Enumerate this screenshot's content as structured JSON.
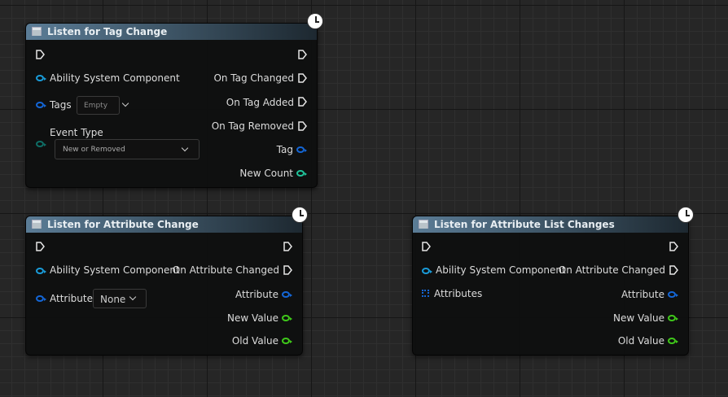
{
  "nodes": {
    "tag_change": {
      "title": "Listen for Tag Change",
      "inputs": {
        "asc": "Ability System Component",
        "tags": "Tags",
        "tags_value": "Empty",
        "event_type": "Event Type",
        "event_type_value": "New or Removed"
      },
      "outputs": {
        "on_changed": "On Tag Changed",
        "on_added": "On Tag Added",
        "on_removed": "On Tag Removed",
        "tag": "Tag",
        "new_count": "New Count"
      }
    },
    "attr_change": {
      "title": "Listen for Attribute Change",
      "inputs": {
        "asc": "Ability System Component",
        "attribute": "Attribute",
        "attribute_value": "None"
      },
      "outputs": {
        "on_changed": "On Attribute Changed",
        "attribute": "Attribute",
        "new_value": "New Value",
        "old_value": "Old Value"
      }
    },
    "attr_list": {
      "title": "Listen for Attribute List Changes",
      "inputs": {
        "asc": "Ability System Component",
        "attributes": "Attributes"
      },
      "outputs": {
        "on_changed": "On Attribute Changed",
        "attribute": "Attribute",
        "new_value": "New Value",
        "old_value": "Old Value"
      }
    }
  },
  "colors": {
    "object_pin": "#1a9bd8",
    "struct_pin": "#1466d6",
    "enum_pin": "#0f6e66",
    "float_pin": "#3fc81a",
    "int_pin": "#20c39a",
    "exec": "#e6e6e6"
  }
}
